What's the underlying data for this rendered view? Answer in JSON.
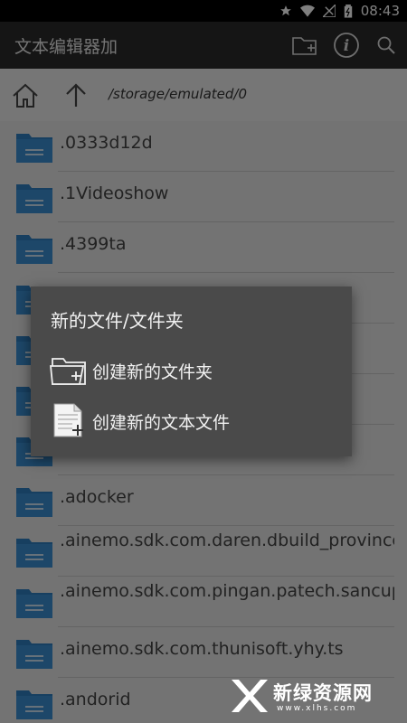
{
  "status_bar": {
    "time": "08:43"
  },
  "app_bar": {
    "title": "文本编辑器加"
  },
  "path_bar": {
    "path": "/storage/emulated/0"
  },
  "file_list": {
    "items": [
      {
        "name": ".0333d12d"
      },
      {
        "name": ".1Videoshow"
      },
      {
        "name": ".4399ta"
      },
      {
        "name": ""
      },
      {
        "name": ""
      },
      {
        "name": ""
      },
      {
        "name": ""
      },
      {
        "name": ".adocker"
      },
      {
        "name": ".ainemo.sdk.com.daren.dbuild_province"
      },
      {
        "name": ".ainemo.sdk.com.pingan.patech.sancuphui"
      },
      {
        "name": ".ainemo.sdk.com.thunisoft.yhy.ts"
      },
      {
        "name": ".andorid"
      }
    ]
  },
  "dialog": {
    "title": "新的文件/文件夹",
    "items": [
      {
        "label": "创建新的文件夹",
        "icon": "new-folder-icon"
      },
      {
        "label": "创建新的文本文件",
        "icon": "new-text-file-icon"
      }
    ]
  },
  "watermark": {
    "text": "新绿资源网",
    "sub": "www.xlhs.com"
  }
}
